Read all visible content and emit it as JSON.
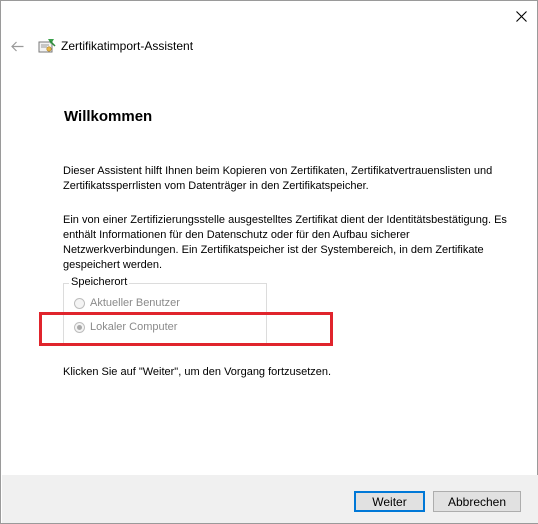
{
  "window": {
    "title": "Zertifikatimport-Assistent",
    "close_icon": "close-icon",
    "back_icon": "back-arrow-icon"
  },
  "content": {
    "heading": "Willkommen",
    "paragraph1": "Dieser Assistent hilft Ihnen beim Kopieren von Zertifikaten, Zertifikatvertrauenslisten und Zertifikatssperrlisten vom Datenträger in den Zertifikatspeicher.",
    "paragraph2": "Ein von einer Zertifizierungsstelle ausgestelltes Zertifikat dient der Identitätsbestätigung. Es enthält Informationen für den Datenschutz oder für den Aufbau sicherer Netzwerkverbindungen. Ein Zertifikatspeicher ist der Systembereich, in dem Zertifikate gespeichert werden.",
    "storage_group": {
      "legend": "Speicherort",
      "options": [
        {
          "label": "Aktueller Benutzer",
          "checked": false,
          "disabled": true
        },
        {
          "label": "Lokaler Computer",
          "checked": true,
          "disabled": true
        }
      ]
    },
    "paragraph3": "Klicken Sie auf \"Weiter\", um den Vorgang fortzusetzen."
  },
  "footer": {
    "next_label": "Weiter",
    "cancel_label": "Abbrechen"
  },
  "colors": {
    "highlight": "#e0242c",
    "default_button_border": "#0078d7",
    "footer_bg": "#f0f0f0"
  }
}
